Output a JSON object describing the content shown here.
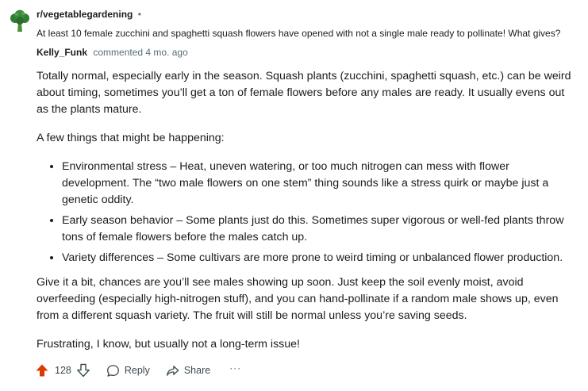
{
  "post": {
    "subreddit": "r/vegetablegardening",
    "separator": "•",
    "title": "At least 10 female zucchini and spaghetti squash flowers have opened with not a single male ready to pollinate! What gives?"
  },
  "comment": {
    "author": "Kelly_Funk",
    "meta": "commented 4 mo. ago",
    "paragraph_1": "Totally normal, especially early in the season. Squash plants (zucchini, spaghetti squash, etc.) can be weird about timing, sometimes you’ll get a ton of female flowers before any males are ready. It usually evens out as the plants mature.",
    "paragraph_2": "A few things that might be happening:",
    "bullets": [
      "Environmental stress – Heat, uneven watering, or too much nitrogen can mess with flower development. The “two male flowers on one stem” thing sounds like a stress quirk or maybe just a genetic oddity.",
      "Early season behavior – Some plants just do this. Sometimes super vigorous or well-fed plants throw tons of female flowers before the males catch up.",
      "Variety differences – Some cultivars are more prone to weird timing or unbalanced flower production."
    ],
    "paragraph_3": "Give it a bit, chances are you’ll see males showing up soon. Just keep the soil evenly moist, avoid overfeeding (especially high-nitrogen stuff), and you can hand-pollinate if a random male shows up, even from a different squash variety. The fruit will still be normal unless you’re saving seeds.",
    "paragraph_4": "Frustrating, I know, but usually not a long-term issue!"
  },
  "actions": {
    "score": "128",
    "reply_label": "Reply",
    "share_label": "Share",
    "more_label": "···"
  },
  "icons": {
    "subreddit": "broccoli-icon",
    "upvote": "upvote-arrow-icon",
    "downvote": "downvote-arrow-icon",
    "reply": "speech-bubble-icon",
    "share": "share-arrow-icon"
  },
  "colors": {
    "upvote_active": "#d93a00",
    "icon_green": "#2f7d32",
    "meta_gray": "#576f76",
    "text": "#1c1c1c"
  }
}
